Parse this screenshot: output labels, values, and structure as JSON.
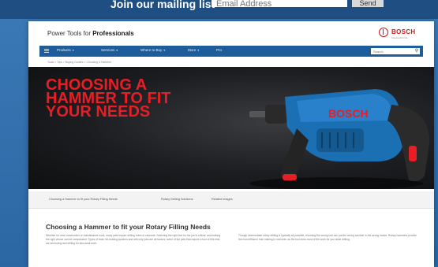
{
  "promo": {
    "text": "Join our mailing list",
    "email_placeholder": "Email Address",
    "send_label": "Send"
  },
  "site": {
    "title_prefix": "Power Tools for ",
    "title_bold": "Professionals",
    "brand_name": "BOSCH",
    "brand_tagline": "Invented for life"
  },
  "nav": {
    "items": [
      {
        "label": "Products",
        "caret": "▾"
      },
      {
        "label": "Services",
        "caret": "▾"
      },
      {
        "label": "Where to Buy",
        "caret": "▾"
      },
      {
        "label": "More",
        "caret": "▾"
      },
      {
        "label": "Pro"
      }
    ],
    "search_placeholder": "Search",
    "search_icon": "magnifier-icon"
  },
  "breadcrumb": "Tools  >  Tips  >  Buying Guides  >  Choosing a Hammer",
  "hero": {
    "lines": [
      "CHOOSING A",
      "HAMMER TO FIT",
      "YOUR NEEDS"
    ],
    "accent_color": "#e61e25"
  },
  "subtabs": [
    "Choosing a Hammer to fit your Rotary Filling Needs",
    "Rotary Drilling Solutions",
    "Related Images"
  ],
  "article": {
    "title": "Choosing a Hammer to fit your Rotary Filling Needs",
    "col1": "Whether for new construction or maintenance work, many jobs require drilling holes in concrete. Selecting the right tool for the job is critical, and making the right choice can be complicated. Types of tools, bit-holding systems and drill-only jobs are all factors; some of the jobs that require a tool of this kind are anchoring and drilling for structural work.",
    "col2": "Though intermediate rotary drilling is typically all possible, choosing the wrong tool can put the wrong solution in the wrong hands. Rotary hammers provide the most efficient hole making in concrete, as the tool does most of the work for you while drilling."
  }
}
